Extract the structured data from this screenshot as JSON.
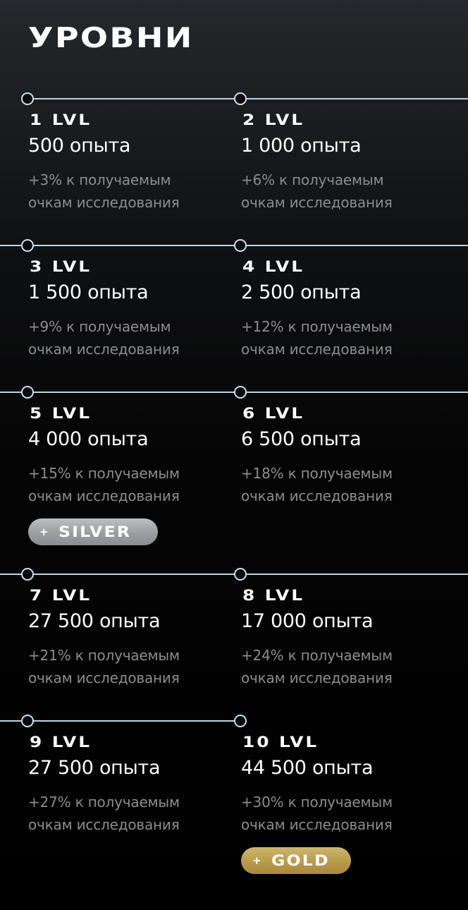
{
  "title": "УРОВНИ",
  "levels": [
    {
      "label": "1 LVL",
      "exp": "500 опыта",
      "bonus": "+3% к получаемым\nочкам исследования"
    },
    {
      "label": "2 LVL",
      "exp": "1 000 опыта",
      "bonus": "+6% к получаемым\nочкам исследования"
    },
    {
      "label": "3 LVL",
      "exp": "1 500 опыта",
      "bonus": "+9% к получаемым\nочкам исследования"
    },
    {
      "label": "4 LVL",
      "exp": "2 500 опыта",
      "bonus": "+12% к получаемым\nочкам исследования"
    },
    {
      "label": "5 LVL",
      "exp": "4 000 опыта",
      "bonus": "+15% к получаемым\nочкам исследования",
      "badge": "SILVER"
    },
    {
      "label": "6 LVL",
      "exp": "6 500 опыта",
      "bonus": "+18% к получаемым\nочкам исследования"
    },
    {
      "label": "7 LVL",
      "exp": "27 500 опыта",
      "bonus": "+21% к получаемым\nочкам исследования"
    },
    {
      "label": "8 LVL",
      "exp": "17 000 опыта",
      "bonus": "+24% к получаемым\nочкам исследования"
    },
    {
      "label": "9 LVL",
      "exp": "27 500 опыта",
      "bonus": "+27% к получаемым\nочкам исследования"
    },
    {
      "label": "10 LVL",
      "exp": "44 500 опыта",
      "bonus": "+30% к получаемым\nочкам исследования",
      "badge": "GOLD"
    }
  ],
  "badge_plus": "+",
  "colors": {
    "line": "#b9d6e6",
    "muted_text": "#8b8c8e",
    "silver": "#a7a8ab",
    "gold": "#bfa252"
  }
}
